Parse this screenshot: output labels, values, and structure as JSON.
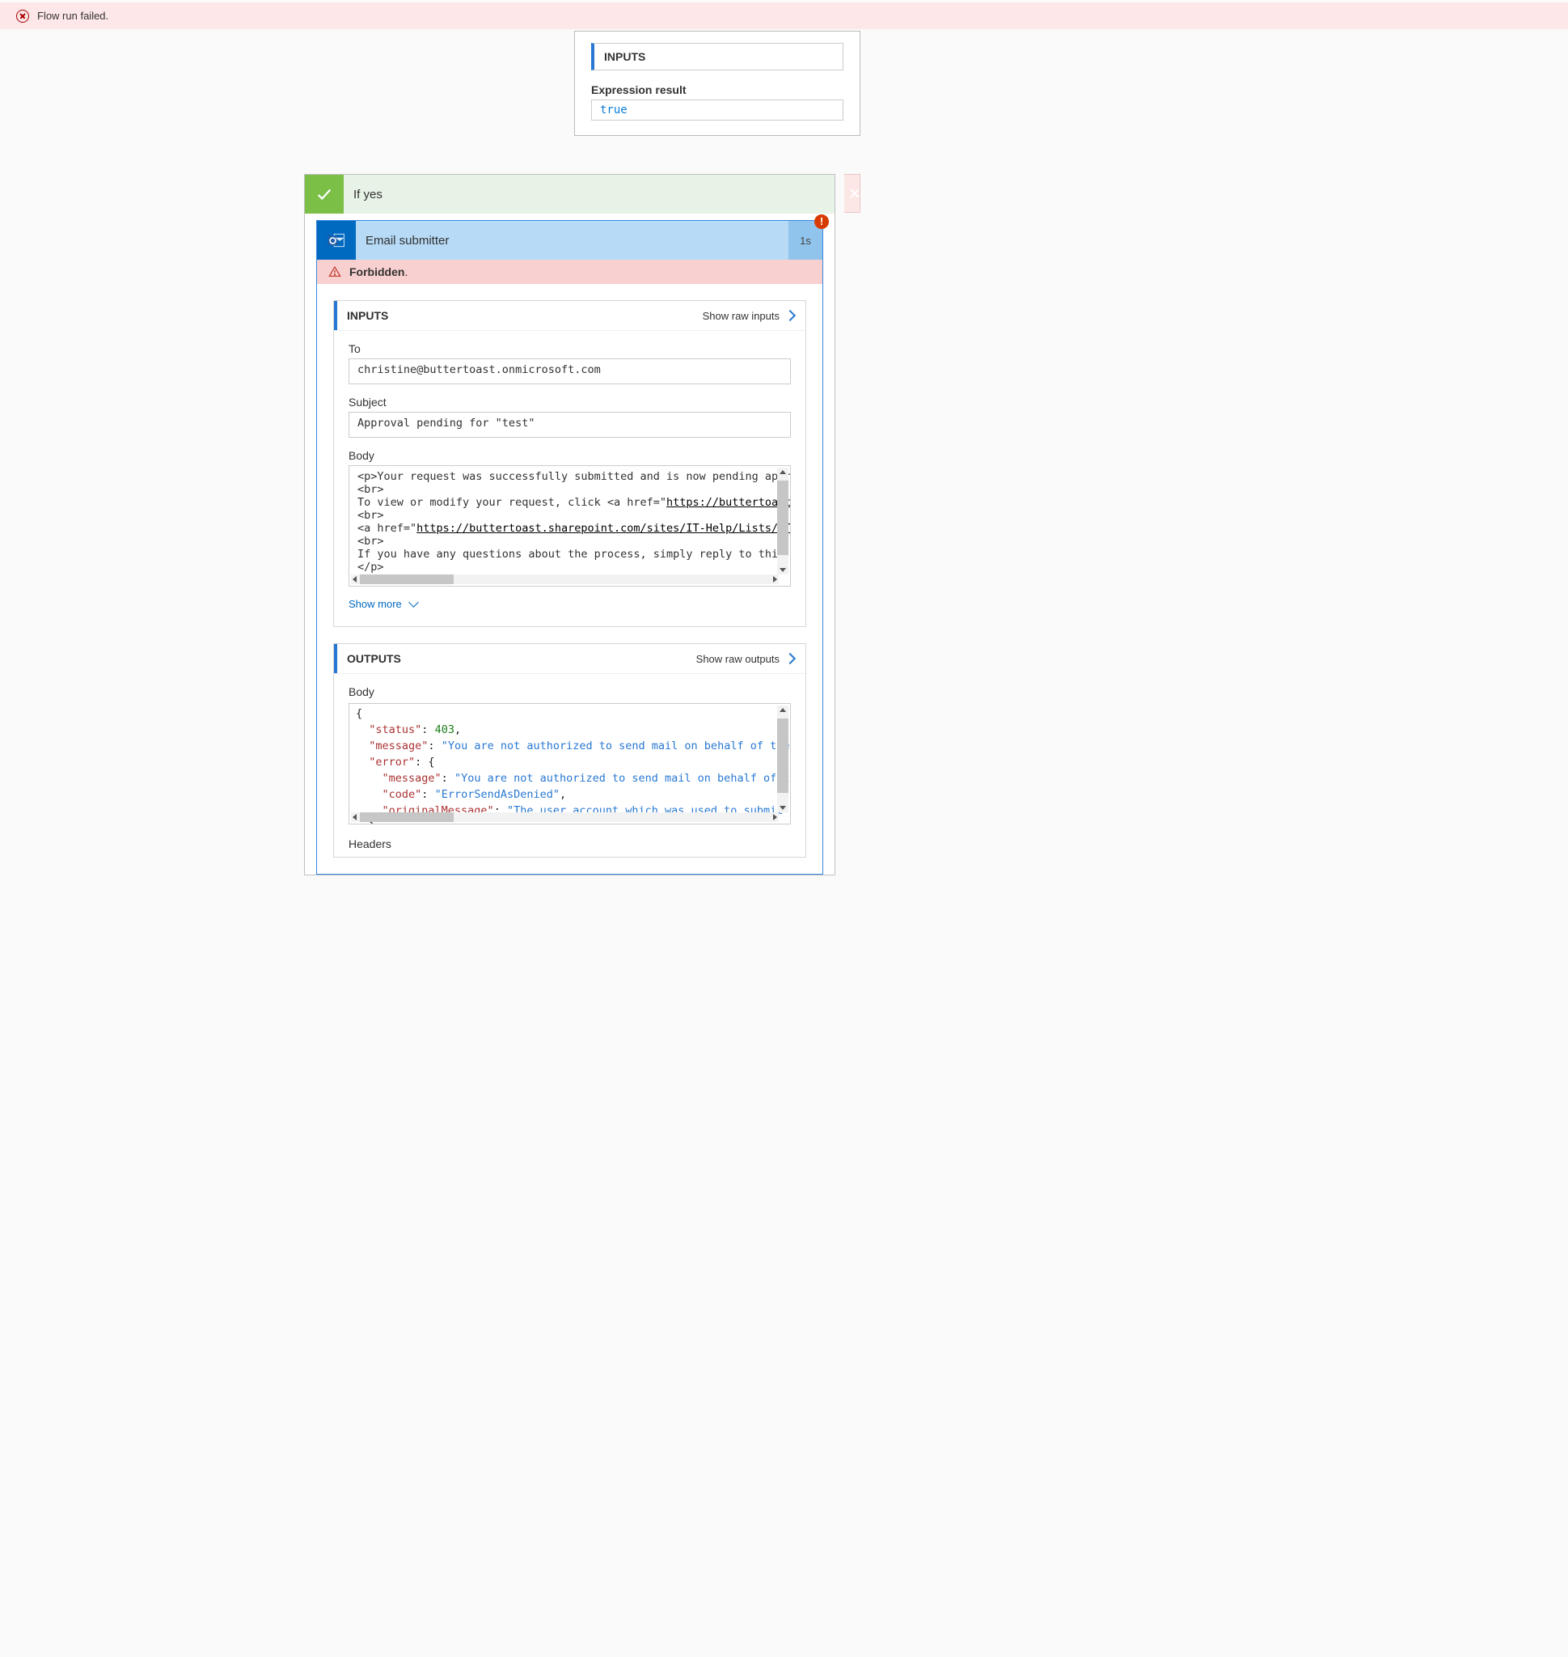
{
  "error_bar": {
    "message": "Flow run failed."
  },
  "expr_panel": {
    "header": "INPUTS",
    "label": "Expression result",
    "value": "true"
  },
  "branch_yes": {
    "title": "If yes"
  },
  "action": {
    "title": "Email submitter",
    "duration": "1s",
    "error_badge": "!",
    "forbidden": "Forbidden"
  },
  "inputs": {
    "header": "INPUTS",
    "raw_link": "Show raw inputs",
    "fields": {
      "to_lab": "To",
      "to_val": "christine@buttertoast.onmicrosoft.com",
      "subj_lab": "Subject",
      "subj_val": "Approval pending for \"test\"",
      "body_lab": "Body",
      "body_line1": "<p>Your request was successfully submitted and is now pending approval.",
      "body_line2": "<br>",
      "body_line3_pre": "To view or modify your request, click <a href=\"",
      "body_line3_link": "https://buttertoast.",
      "body_line4": "<br>",
      "body_line5_pre": "<a href=\"",
      "body_line5_link": "https://buttertoast.sharepoint.com/sites/IT-Help/Lists/IT%",
      "body_line6": "<br>",
      "body_line7": "If you have any questions about the process, simply reply to this e",
      "body_line8": "</p>"
    },
    "show_more": "Show more"
  },
  "outputs": {
    "header": "OUTPUTS",
    "raw_link": "Show raw outputs",
    "body_lab": "Body",
    "json": {
      "status": 403,
      "message": "You are not authorized to send mail on behalf of the",
      "error": {
        "message": "You are not authorized to send mail on behalf of th",
        "code": "ErrorSendAsDenied",
        "originalMessage": "The user account which was used to submit t"
      }
    },
    "headers_lab": "Headers"
  }
}
